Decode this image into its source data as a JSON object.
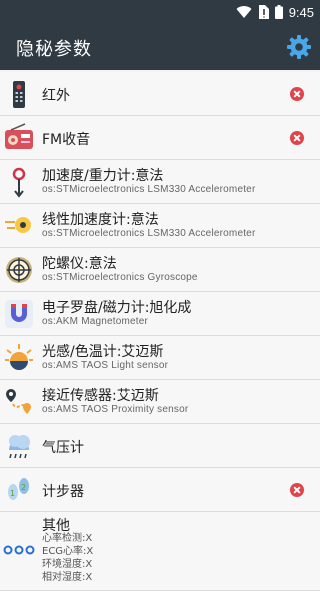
{
  "status_bar": {
    "time": "9:45"
  },
  "app_bar": {
    "title": "隐秘参数",
    "settings_icon": "gear-icon"
  },
  "accent_color": "#2f3a43",
  "rows": [
    {
      "title": "红外",
      "subtitle": "",
      "icon": "remote-control-icon",
      "removable": true
    },
    {
      "title": "FM收音",
      "subtitle": "",
      "icon": "radio-icon",
      "removable": true
    },
    {
      "title": "加速度/重力计:意法",
      "subtitle": "os:STMicroelectronics LSM330 Accelerometer",
      "icon": "accelerometer-icon",
      "removable": false
    },
    {
      "title": "线性加速度计:意法",
      "subtitle": "os:STMicroelectronics LSM330 Accelerometer",
      "icon": "linear-acceleration-icon",
      "removable": false
    },
    {
      "title": "陀螺仪:意法",
      "subtitle": "os:STMicroelectronics Gyroscope",
      "icon": "gyroscope-icon",
      "removable": false
    },
    {
      "title": "电子罗盘/磁力计:旭化成",
      "subtitle": "os:AKM Magnetometer",
      "icon": "magnet-icon",
      "removable": false
    },
    {
      "title": "光感/色温计:艾迈斯",
      "subtitle": "os:AMS TAOS Light sensor",
      "icon": "light-sensor-icon",
      "removable": false
    },
    {
      "title": "接近传感器:艾迈斯",
      "subtitle": "os:AMS TAOS Proximity sensor",
      "icon": "proximity-icon",
      "removable": false
    },
    {
      "title": "气压计",
      "subtitle": "",
      "icon": "barometer-icon",
      "removable": false
    },
    {
      "title": "计步器",
      "subtitle": "",
      "icon": "footsteps-icon",
      "removable": true
    }
  ],
  "other": {
    "title": "其他",
    "icon": "more-dots-icon",
    "lines": [
      "心率检测:X",
      "ECG心率:X",
      "环境湿度:X",
      "相对湿度:X"
    ]
  }
}
